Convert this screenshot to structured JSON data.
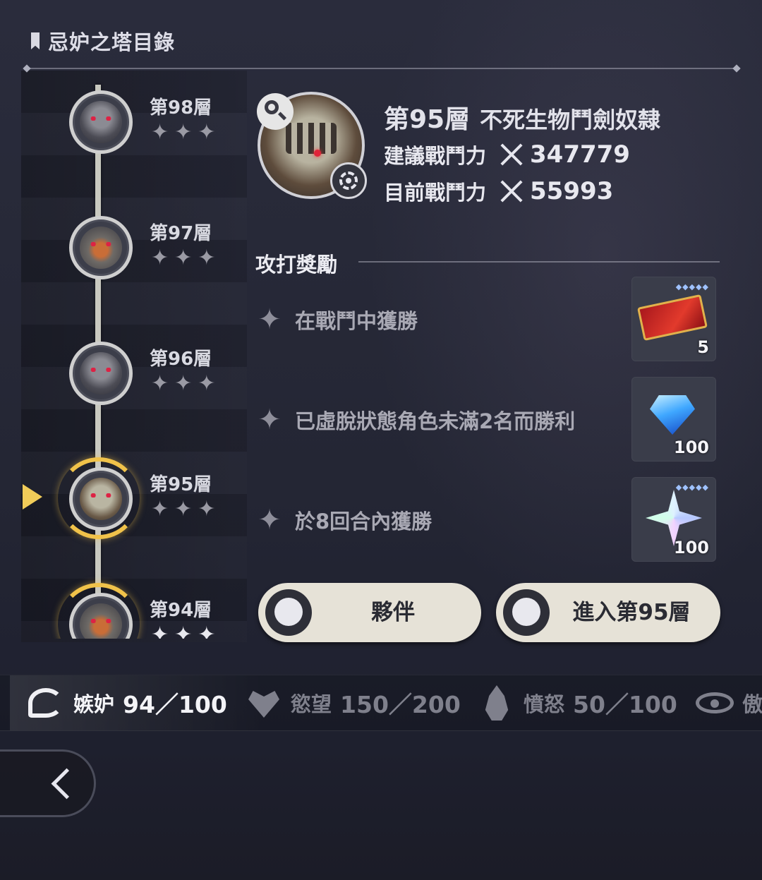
{
  "header": {
    "title": "忌妒之塔目錄"
  },
  "floors": [
    {
      "name": "第98層",
      "stars": "✦✦✦"
    },
    {
      "name": "第97層",
      "stars": "✦✦✦"
    },
    {
      "name": "第96層",
      "stars": "✦✦✦"
    },
    {
      "name": "第95層",
      "stars": "✦✦✦"
    },
    {
      "name": "第94層",
      "stars": "✦✦✦"
    }
  ],
  "current_floor_index": 3,
  "stage": {
    "floor": "第95層",
    "name": "不死生物鬥劍奴隸",
    "recommended_label": "建議戰鬥力",
    "recommended_value": "347779",
    "current_label": "目前戰鬥力",
    "current_value": "55993"
  },
  "rewards": {
    "heading": "攻打獎勵",
    "items": [
      {
        "condition": "在戰鬥中獲勝",
        "icon": "red-ticket-icon",
        "count": "5"
      },
      {
        "condition": "已虛脫狀態角色未滿2名而勝利",
        "icon": "blue-gem-icon",
        "count": "100"
      },
      {
        "condition": "於8回合內獲勝",
        "icon": "star-crystal-icon",
        "count": "100"
      }
    ]
  },
  "buttons": {
    "partner": "夥伴",
    "enter": "進入第95層"
  },
  "sins": [
    {
      "label": "嫉妒",
      "value": "94／100",
      "icon": "snake-icon"
    },
    {
      "label": "慾望",
      "value": "150／200",
      "icon": "heart-icon"
    },
    {
      "label": "憤怒",
      "value": "50／100",
      "icon": "flame-icon"
    },
    {
      "label": "傲",
      "value": "",
      "icon": "eye-icon"
    }
  ],
  "colors": {
    "accent": "#f0c24a",
    "button_bg": "#e6e2d7"
  }
}
